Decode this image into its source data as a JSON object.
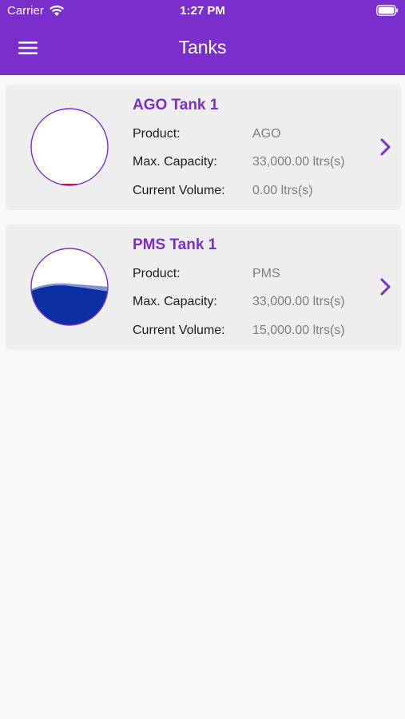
{
  "status_bar": {
    "carrier": "Carrier",
    "time": "1:27 PM"
  },
  "nav": {
    "title": "Tanks",
    "menu_icon": "hamburger-menu-icon"
  },
  "colors": {
    "primary": "#7a2ecb",
    "card_bg": "#eeeeee",
    "page_bg": "#f8f8f8",
    "ago_fill": "#c0172b",
    "pms_fill": "#0b2fa3"
  },
  "tanks": [
    {
      "name": "AGO Tank 1",
      "product_label": "Product:",
      "product": "AGO",
      "capacity_label": "Max. Capacity:",
      "capacity": "33,000.00 ltrs(s)",
      "volume_label": "Current Volume:",
      "volume": "0.00 ltrs(s)",
      "fill_fraction": 0.0
    },
    {
      "name": "PMS Tank 1",
      "product_label": "Product:",
      "product": "PMS",
      "capacity_label": "Max. Capacity:",
      "capacity": "33,000.00 ltrs(s)",
      "volume_label": "Current Volume:",
      "volume": "15,000.00 ltrs(s)",
      "fill_fraction": 0.4545
    }
  ]
}
